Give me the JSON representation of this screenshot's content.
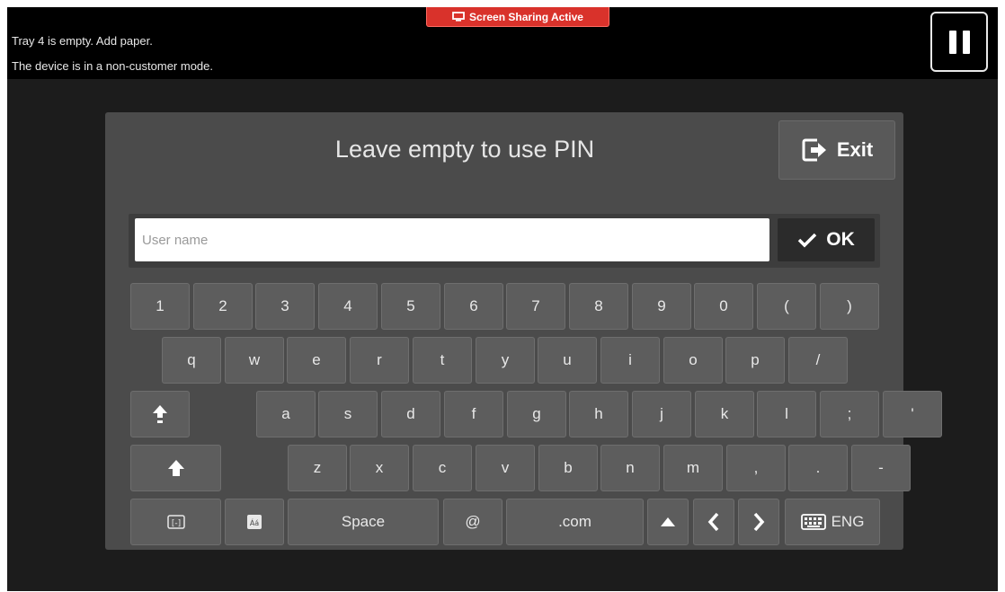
{
  "status": {
    "line1": "Tray 4 is empty.  Add paper.",
    "line2": "The device is in a non-customer mode."
  },
  "share_badge": {
    "label": "Screen Sharing Active",
    "icon": "screen-share-icon"
  },
  "pause_button": {
    "icon": "pause-icon"
  },
  "dialog": {
    "title": "Leave empty to use PIN",
    "exit_label": "Exit",
    "exit_icon": "exit-icon"
  },
  "username": {
    "placeholder": "User name",
    "value": ""
  },
  "ok": {
    "label": "OK",
    "icon": "check-icon"
  },
  "keyboard": {
    "row1": [
      "1",
      "2",
      "3",
      "4",
      "5",
      "6",
      "7",
      "8",
      "9",
      "0",
      "(",
      ")"
    ],
    "row2": [
      "q",
      "w",
      "e",
      "r",
      "t",
      "y",
      "u",
      "i",
      "o",
      "p",
      "/"
    ],
    "row3": [
      "a",
      "s",
      "d",
      "f",
      "g",
      "h",
      "j",
      "k",
      "l",
      ";",
      "'"
    ],
    "row4": [
      "z",
      "x",
      "c",
      "v",
      "b",
      "n",
      "m",
      ",",
      ".",
      "-"
    ],
    "space_label": "Space",
    "at_label": "@",
    "dotcom_label": ".com",
    "lang_label": "ENG"
  },
  "colors": {
    "background": "#1c1c1c",
    "dialog": "#4b4b4b",
    "key": "#5d5d5d",
    "badge": "#d9322b"
  }
}
